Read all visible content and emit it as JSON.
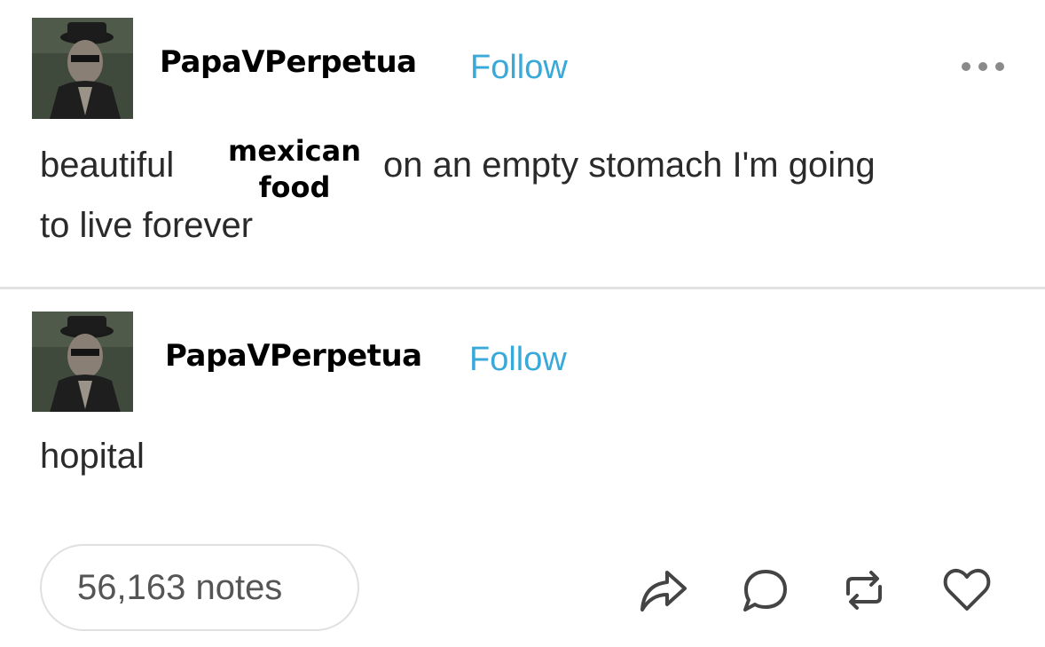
{
  "post1": {
    "username": "PapaVPerpetua",
    "follow_label": "Follow",
    "text_part1": "beautiful",
    "text_part2": "on an empty stomach I'm going",
    "text_line2": "to live forever",
    "overlay_line1": "mexican",
    "overlay_line2": "food",
    "more_icon": "more-horizontal-icon"
  },
  "post2": {
    "username": "PapaVPerpetua",
    "follow_label": "Follow",
    "text": "hopital"
  },
  "footer": {
    "notes_label": "56,163 notes",
    "icons": [
      "share-icon",
      "reply-icon",
      "reblog-icon",
      "like-icon"
    ]
  },
  "colors": {
    "follow": "#38a9d9",
    "text": "#2a2a2a",
    "divider": "#e2e2e2"
  }
}
